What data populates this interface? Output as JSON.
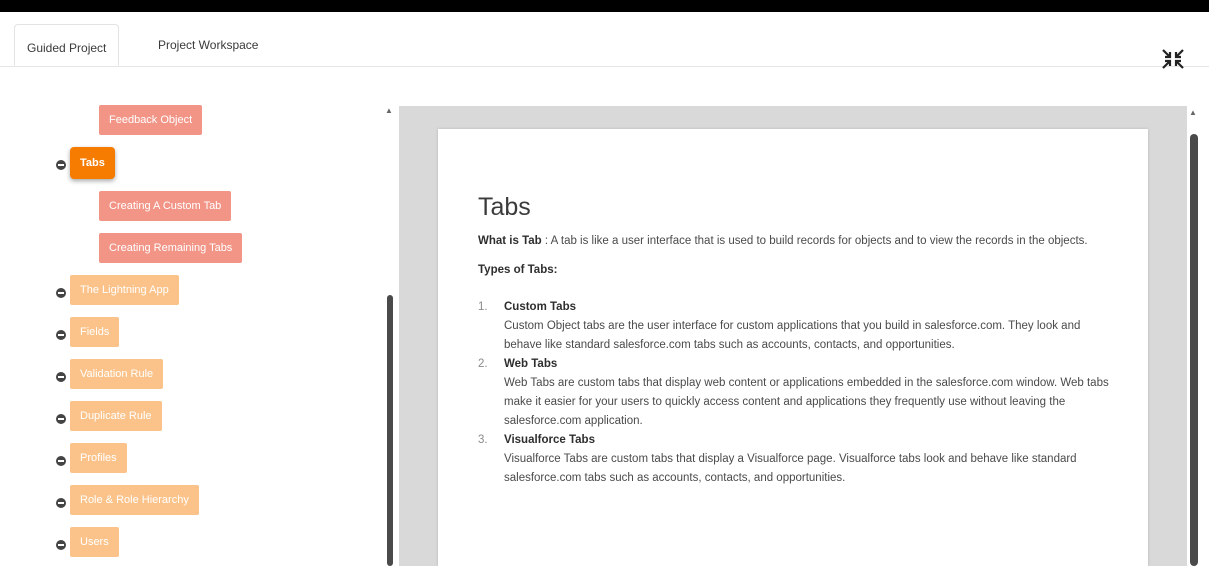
{
  "tabs": {
    "guided": "Guided Project",
    "workspace": "Project Workspace"
  },
  "sidebar": {
    "items": [
      {
        "label": "Feedback Object"
      },
      {
        "label": "Tabs"
      },
      {
        "label": "Creating A Custom Tab"
      },
      {
        "label": "Creating Remaining Tabs"
      },
      {
        "label": "The Lightning App"
      },
      {
        "label": "Fields"
      },
      {
        "label": "Validation Rule"
      },
      {
        "label": "Duplicate Rule"
      },
      {
        "label": "Profiles"
      },
      {
        "label": "Role & Role Hierarchy"
      },
      {
        "label": "Users"
      }
    ]
  },
  "doc": {
    "title": "Tabs",
    "intro_term": "What is Tab",
    "intro_text": ": A tab is like a user interface that is used to build records for objects and to view the records in the objects.",
    "types_heading": "Types of Tabs:",
    "list": [
      {
        "num": "1.",
        "title": "Custom Tabs",
        "body": "Custom Object tabs are the user interface for custom applications that you build in salesforce.com. They look and behave like standard salesforce.com tabs such as accounts, contacts, and opportunities."
      },
      {
        "num": "2.",
        "title": "Web Tabs",
        "body": "Web Tabs are custom tabs that display web content or applications embedded in the salesforce.com window. Web tabs make it easier for your users to quickly access content and applications they frequently use without leaving the salesforce.com application."
      },
      {
        "num": "3.",
        "title": "Visualforce Tabs",
        "body": "Visualforce Tabs are custom tabs that display a Visualforce page. Visualforce tabs look and behave like standard salesforce.com tabs such as accounts, contacts, and opportunities."
      }
    ]
  },
  "colors": {
    "active": "#f57c00",
    "sub": "#f29587",
    "top": "#fbc38a"
  },
  "icons": {
    "collapse": "collapse-icon",
    "bullet": "minus-circle-icon"
  }
}
